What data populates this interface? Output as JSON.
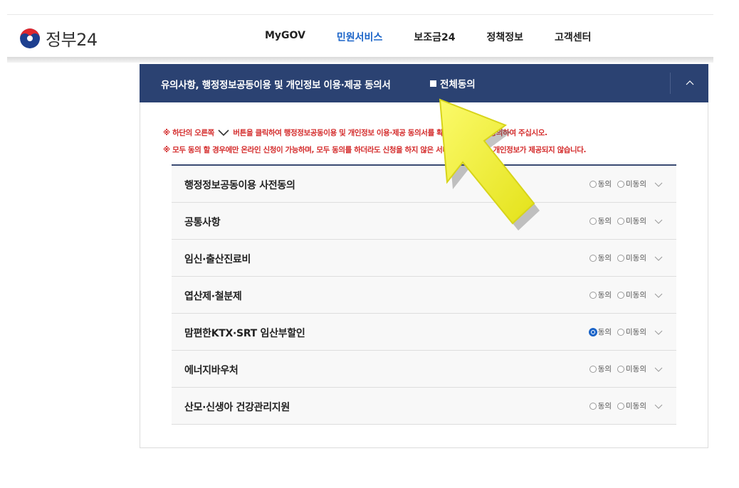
{
  "header": {
    "logo_text": "정부24",
    "nav": [
      {
        "label": "MyGOV",
        "active": false
      },
      {
        "label": "민원서비스",
        "active": true
      },
      {
        "label": "보조금24",
        "active": false
      },
      {
        "label": "정책정보",
        "active": false
      },
      {
        "label": "고객센터",
        "active": false
      }
    ]
  },
  "panel": {
    "title": "유의사항, 행정정보공동이용 및 개인정보 이용·제공 동의서",
    "all_agree_label": "전체동의",
    "notice_1_pre": "※ 하단의 오른쪽",
    "notice_1_post": "버튼을 클릭하여 행정정보공동이용 및 개인정보 이용·제공 동의서를 확인하여 보신 후 동의하여 주십시오.",
    "notice_2": "※ 모두 동의 할 경우에만 온라인 신청이 가능하며, 모두 동의를 하더라도 신청을 하지 않은 서비스에 대해서는 개인정보가 제공되지 않습니다.",
    "agree_label": "동의",
    "disagree_label": "미동의",
    "items": [
      {
        "label": "행정정보공동이용 사전동의",
        "agree_checked": false
      },
      {
        "label": "공통사항",
        "agree_checked": false
      },
      {
        "label": "임신·출산진료비",
        "agree_checked": false
      },
      {
        "label": "엽산제·철분제",
        "agree_checked": false
      },
      {
        "label": "맘편한KTX·SRT 임산부할인",
        "agree_checked": true
      },
      {
        "label": "에너지바우처",
        "agree_checked": false
      },
      {
        "label": "산모·신생아 건강관리지원",
        "agree_checked": false
      }
    ]
  },
  "colors": {
    "header_bar": "#2b4272",
    "active_nav": "#1b64c8",
    "notice_red": "#d42b2b",
    "arrow_yellow": "#f2f03a"
  },
  "overlay": {
    "arrow_icon": "yellow-pointer-arrow"
  }
}
